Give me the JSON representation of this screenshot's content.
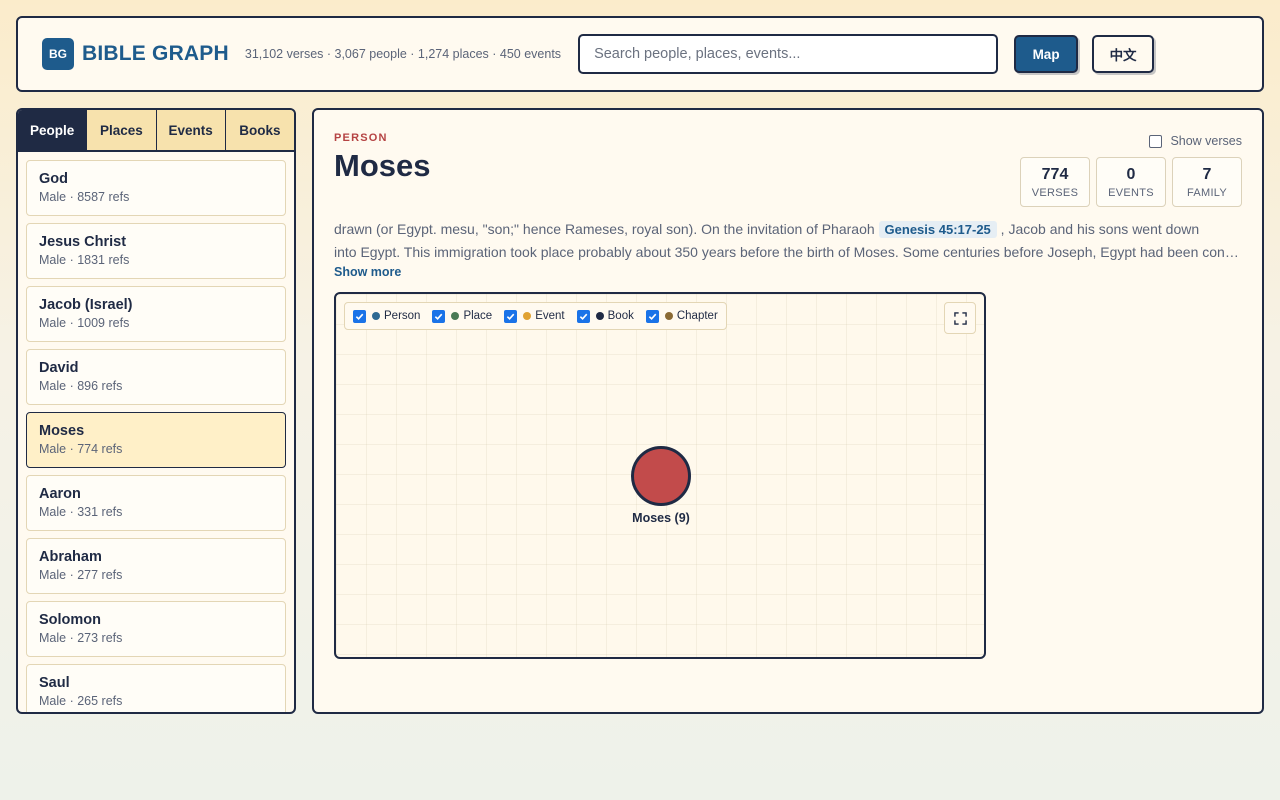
{
  "header": {
    "logo_abbr": "BG",
    "app_title": "BIBLE GRAPH",
    "stats": "31,102 verses · 3,067 people · 1,274 places · 450 events",
    "search_placeholder": "Search people, places, events...",
    "map_label": "Map",
    "lang_label": "中文"
  },
  "sidebar": {
    "tabs": [
      {
        "label": "People",
        "active": true
      },
      {
        "label": "Places",
        "active": false
      },
      {
        "label": "Events",
        "active": false
      },
      {
        "label": "Books",
        "active": false
      }
    ],
    "items": [
      {
        "name": "God",
        "meta": "Male · 8587 refs"
      },
      {
        "name": "Jesus Christ",
        "meta": "Male · 1831 refs"
      },
      {
        "name": "Jacob (Israel)",
        "meta": "Male · 1009 refs"
      },
      {
        "name": "David",
        "meta": "Male · 896 refs"
      },
      {
        "name": "Moses",
        "meta": "Male · 774 refs",
        "active": true
      },
      {
        "name": "Aaron",
        "meta": "Male · 331 refs"
      },
      {
        "name": "Abraham",
        "meta": "Male · 277 refs"
      },
      {
        "name": "Solomon",
        "meta": "Male · 273 refs"
      },
      {
        "name": "Saul",
        "meta": "Male · 265 refs"
      }
    ]
  },
  "detail": {
    "kind": "PERSON",
    "title": "Moses",
    "show_verses_label": "Show verses",
    "stats": {
      "verses_num": "774",
      "verses_label": "VERSES",
      "events_num": "0",
      "events_label": "EVENTS",
      "family_num": "7",
      "family_label": "FAMILY"
    },
    "desc_pre": "drawn (or Egypt. mesu, \"son;\" hence Rameses, royal son). On the invitation of Pharaoh ",
    "desc_ref": "Genesis 45:17-25",
    "desc_post": " , Jacob and his sons went down",
    "desc_line2": "into Egypt. This immigration took place probably about 350 years before the birth of Moses. Some centuries before Joseph, Egypt had been conquered by a pastoral Semitic race from Asia",
    "show_more": "Show more"
  },
  "graph": {
    "legend": [
      {
        "label": "Person",
        "color": "#2f6a93"
      },
      {
        "label": "Place",
        "color": "#4a7a55"
      },
      {
        "label": "Event",
        "color": "#e0a232"
      },
      {
        "label": "Book",
        "color": "#1f2a44"
      },
      {
        "label": "Chapter",
        "color": "#8a6a34"
      }
    ],
    "node_label": "Moses (9)",
    "node_color": "#c24b4b"
  }
}
